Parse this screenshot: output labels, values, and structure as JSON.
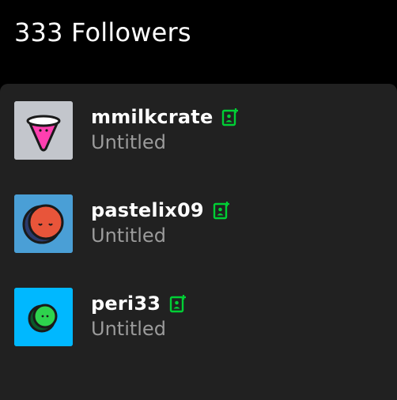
{
  "header": {
    "title": "333 Followers"
  },
  "colors": {
    "background": "#000000",
    "panel": "#212121",
    "follow_accent": "#00cf35",
    "secondary_text": "#9b9b9b"
  },
  "followers": [
    {
      "username": "mmilkcrate",
      "blog_title": "Untitled",
      "avatar_bg": "#c3c6cc",
      "follow_icon": "add-contact-icon"
    },
    {
      "username": "pastelix09",
      "blog_title": "Untitled",
      "avatar_bg": "#4a9fd6",
      "follow_icon": "add-contact-icon"
    },
    {
      "username": "peri33",
      "blog_title": "Untitled",
      "avatar_bg": "#00b8ff",
      "follow_icon": "add-contact-icon"
    }
  ]
}
